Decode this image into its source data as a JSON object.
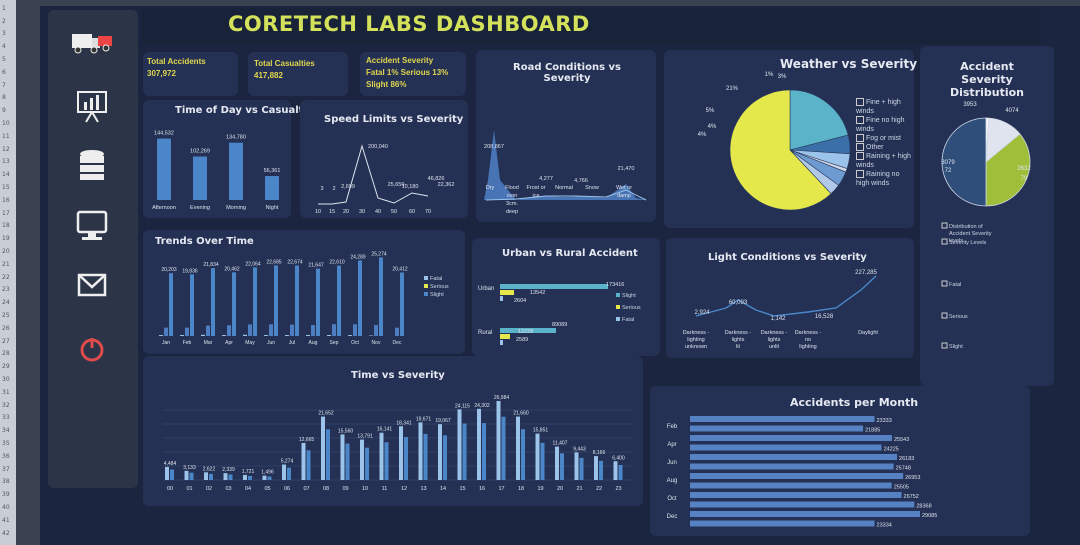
{
  "dashboard": {
    "title": "CORETECH LABS DASHBOARD"
  },
  "sidebar": {
    "icons": [
      "vehicle-crash-icon",
      "presentation-chart-icon",
      "database-icon",
      "monitor-icon",
      "mail-icon",
      "power-icon"
    ]
  },
  "kpis": {
    "total_accidents_label": "Total Accidents",
    "total_accidents_value": "307,972",
    "total_casualties_label": "Total Casualties",
    "total_casualties_value": "417,882",
    "severity_label": "Accident Severity",
    "severity_line1": "Fatal 1% Serious 13%",
    "severity_line2": "Slight 86%"
  },
  "colors": {
    "bar": "#4a86c8",
    "bar_light": "#9cc3ea",
    "yellow": "#e5e84a",
    "teal": "#5bb3c9",
    "green": "#9fbe3a",
    "accent": "#d4e15a"
  },
  "chart_data": [
    {
      "id": "time_of_day",
      "type": "bar",
      "title": "Time of Day vs Casualties",
      "categories": [
        "Afternoon",
        "Evening",
        "Morning",
        "Night"
      ],
      "values": [
        144532,
        102269,
        134780,
        56361
      ],
      "labels": [
        "144,532",
        "102,269",
        "134,780",
        "56,361"
      ]
    },
    {
      "id": "speed",
      "type": "line",
      "title": "Speed Limits vs Severity",
      "categories": [
        "10",
        "15",
        "20",
        "30",
        "40",
        "50",
        "60",
        "70"
      ],
      "labels": [
        "3",
        "2",
        "2,699",
        "200,040",
        "25,650",
        "10,180",
        "46,826",
        "22,362"
      ]
    },
    {
      "id": "road",
      "type": "area",
      "title": "Road Conditions vs Severity",
      "categories": [
        "Dry",
        "Flood over 3cm. deep",
        "Frost or ice",
        "Normal",
        "Snow",
        "Wet or damp"
      ],
      "labels": [
        "208,867",
        "4,277",
        "4,766",
        "21,470"
      ]
    },
    {
      "id": "weather",
      "type": "pie",
      "title": "Weather vs Severity",
      "labels": [
        "21%",
        "5%",
        "4%",
        "1%",
        "4%",
        "3%"
      ],
      "legend": [
        "Fine + high winds",
        "Fine no high winds",
        "Fog or mist",
        "Other",
        "Raining + high winds",
        "Raining no high winds"
      ]
    },
    {
      "id": "severity_dist",
      "type": "pie",
      "title": "Accident Severity Distribution",
      "labels": [
        "3953",
        "4074",
        "3079",
        "72",
        "2632",
        "79"
      ],
      "legend": [
        "Distribution of Accident Severity levels",
        "Severity Levels",
        "Fatal",
        "Serious",
        "Slight"
      ]
    },
    {
      "id": "trends",
      "type": "bar",
      "title": "Trends Over Time",
      "categories": [
        "Jan",
        "Feb",
        "Mar",
        "Apr",
        "May",
        "Jun",
        "Jul",
        "Aug",
        "Sep",
        "Oct",
        "Nov",
        "Dec"
      ],
      "series": [
        {
          "name": "Fatal",
          "values": [
            305,
            325,
            379,
            313,
            403,
            309,
            313,
            329,
            329,
            294,
            155,
            0
          ]
        },
        {
          "name": "Serious",
          "values": [
            2676,
            2681,
            3339,
            3451,
            3716,
            3754,
            3665,
            3497,
            3817,
            3759,
            3522,
            2667
          ]
        },
        {
          "name": "Slight",
          "values": [
            20203,
            19836,
            21834,
            20462,
            22064,
            22685,
            22674,
            21647,
            22610,
            24289,
            25274,
            20412
          ]
        }
      ],
      "labels_top": [
        "20,203",
        "19,836",
        "21,834",
        "20,462",
        "22,064",
        "22,685",
        "22,674",
        "21,647",
        "22,610",
        "24,289",
        "25,274",
        "20,412"
      ],
      "legend": [
        "Fatal",
        "Serious",
        "Slight"
      ]
    },
    {
      "id": "urban_rural",
      "type": "bar",
      "title": "Urban vs Rural Accident",
      "categories": [
        "Urban",
        "Rural"
      ],
      "labels": [
        "173416",
        "13542",
        "2604",
        "89089",
        "12228",
        "2589"
      ],
      "legend": [
        "Slight",
        "Serious",
        "Fatal"
      ]
    },
    {
      "id": "light",
      "type": "line",
      "title": "Light Conditions vs Severity",
      "categories": [
        "Darkness - lighting unknown",
        "Darkness - lights lit",
        "Darkness - lights unlit",
        "Darkness - no lighting",
        "Daylight"
      ],
      "labels": [
        "2,924",
        "60,093",
        "1,142",
        "16,528",
        "227,285"
      ]
    },
    {
      "id": "time_sev",
      "type": "bar",
      "title": "Time vs Severity",
      "categories": [
        "00",
        "01",
        "02",
        "03",
        "04",
        "05",
        "06",
        "07",
        "08",
        "09",
        "10",
        "11",
        "12",
        "13",
        "14",
        "15",
        "16",
        "17",
        "18",
        "19",
        "20",
        "21",
        "22",
        "23"
      ],
      "values": [
        4484,
        3133,
        2622,
        2339,
        1721,
        1496,
        5274,
        12665,
        21652,
        15560,
        13791,
        16141,
        18341,
        19671,
        19067,
        24115,
        24302,
        26984,
        21660,
        15851,
        11407,
        9443,
        8166,
        6400
      ],
      "labels": [
        "4,484",
        "3,133",
        "2,622",
        "2,339",
        "1,721",
        "1,496",
        "5,274",
        "12,665",
        "21,652",
        "15,560",
        "13,791",
        "16,141",
        "18,341",
        "19,671",
        "19,067",
        "24,115",
        "24,302",
        "26,984",
        "21,660",
        "15,851",
        "11,407",
        "9,443",
        "8,166",
        "6,400"
      ]
    },
    {
      "id": "accidents_month",
      "type": "bar",
      "title": "Accidents per Month",
      "categories": [
        "Feb",
        "Apr",
        "Jun",
        "Aug",
        "Oct",
        "Dec"
      ],
      "values": [
        23333,
        21885,
        25543,
        24225,
        26183,
        25748,
        26953,
        25505,
        26752,
        28368,
        29085,
        23334
      ]
    }
  ]
}
